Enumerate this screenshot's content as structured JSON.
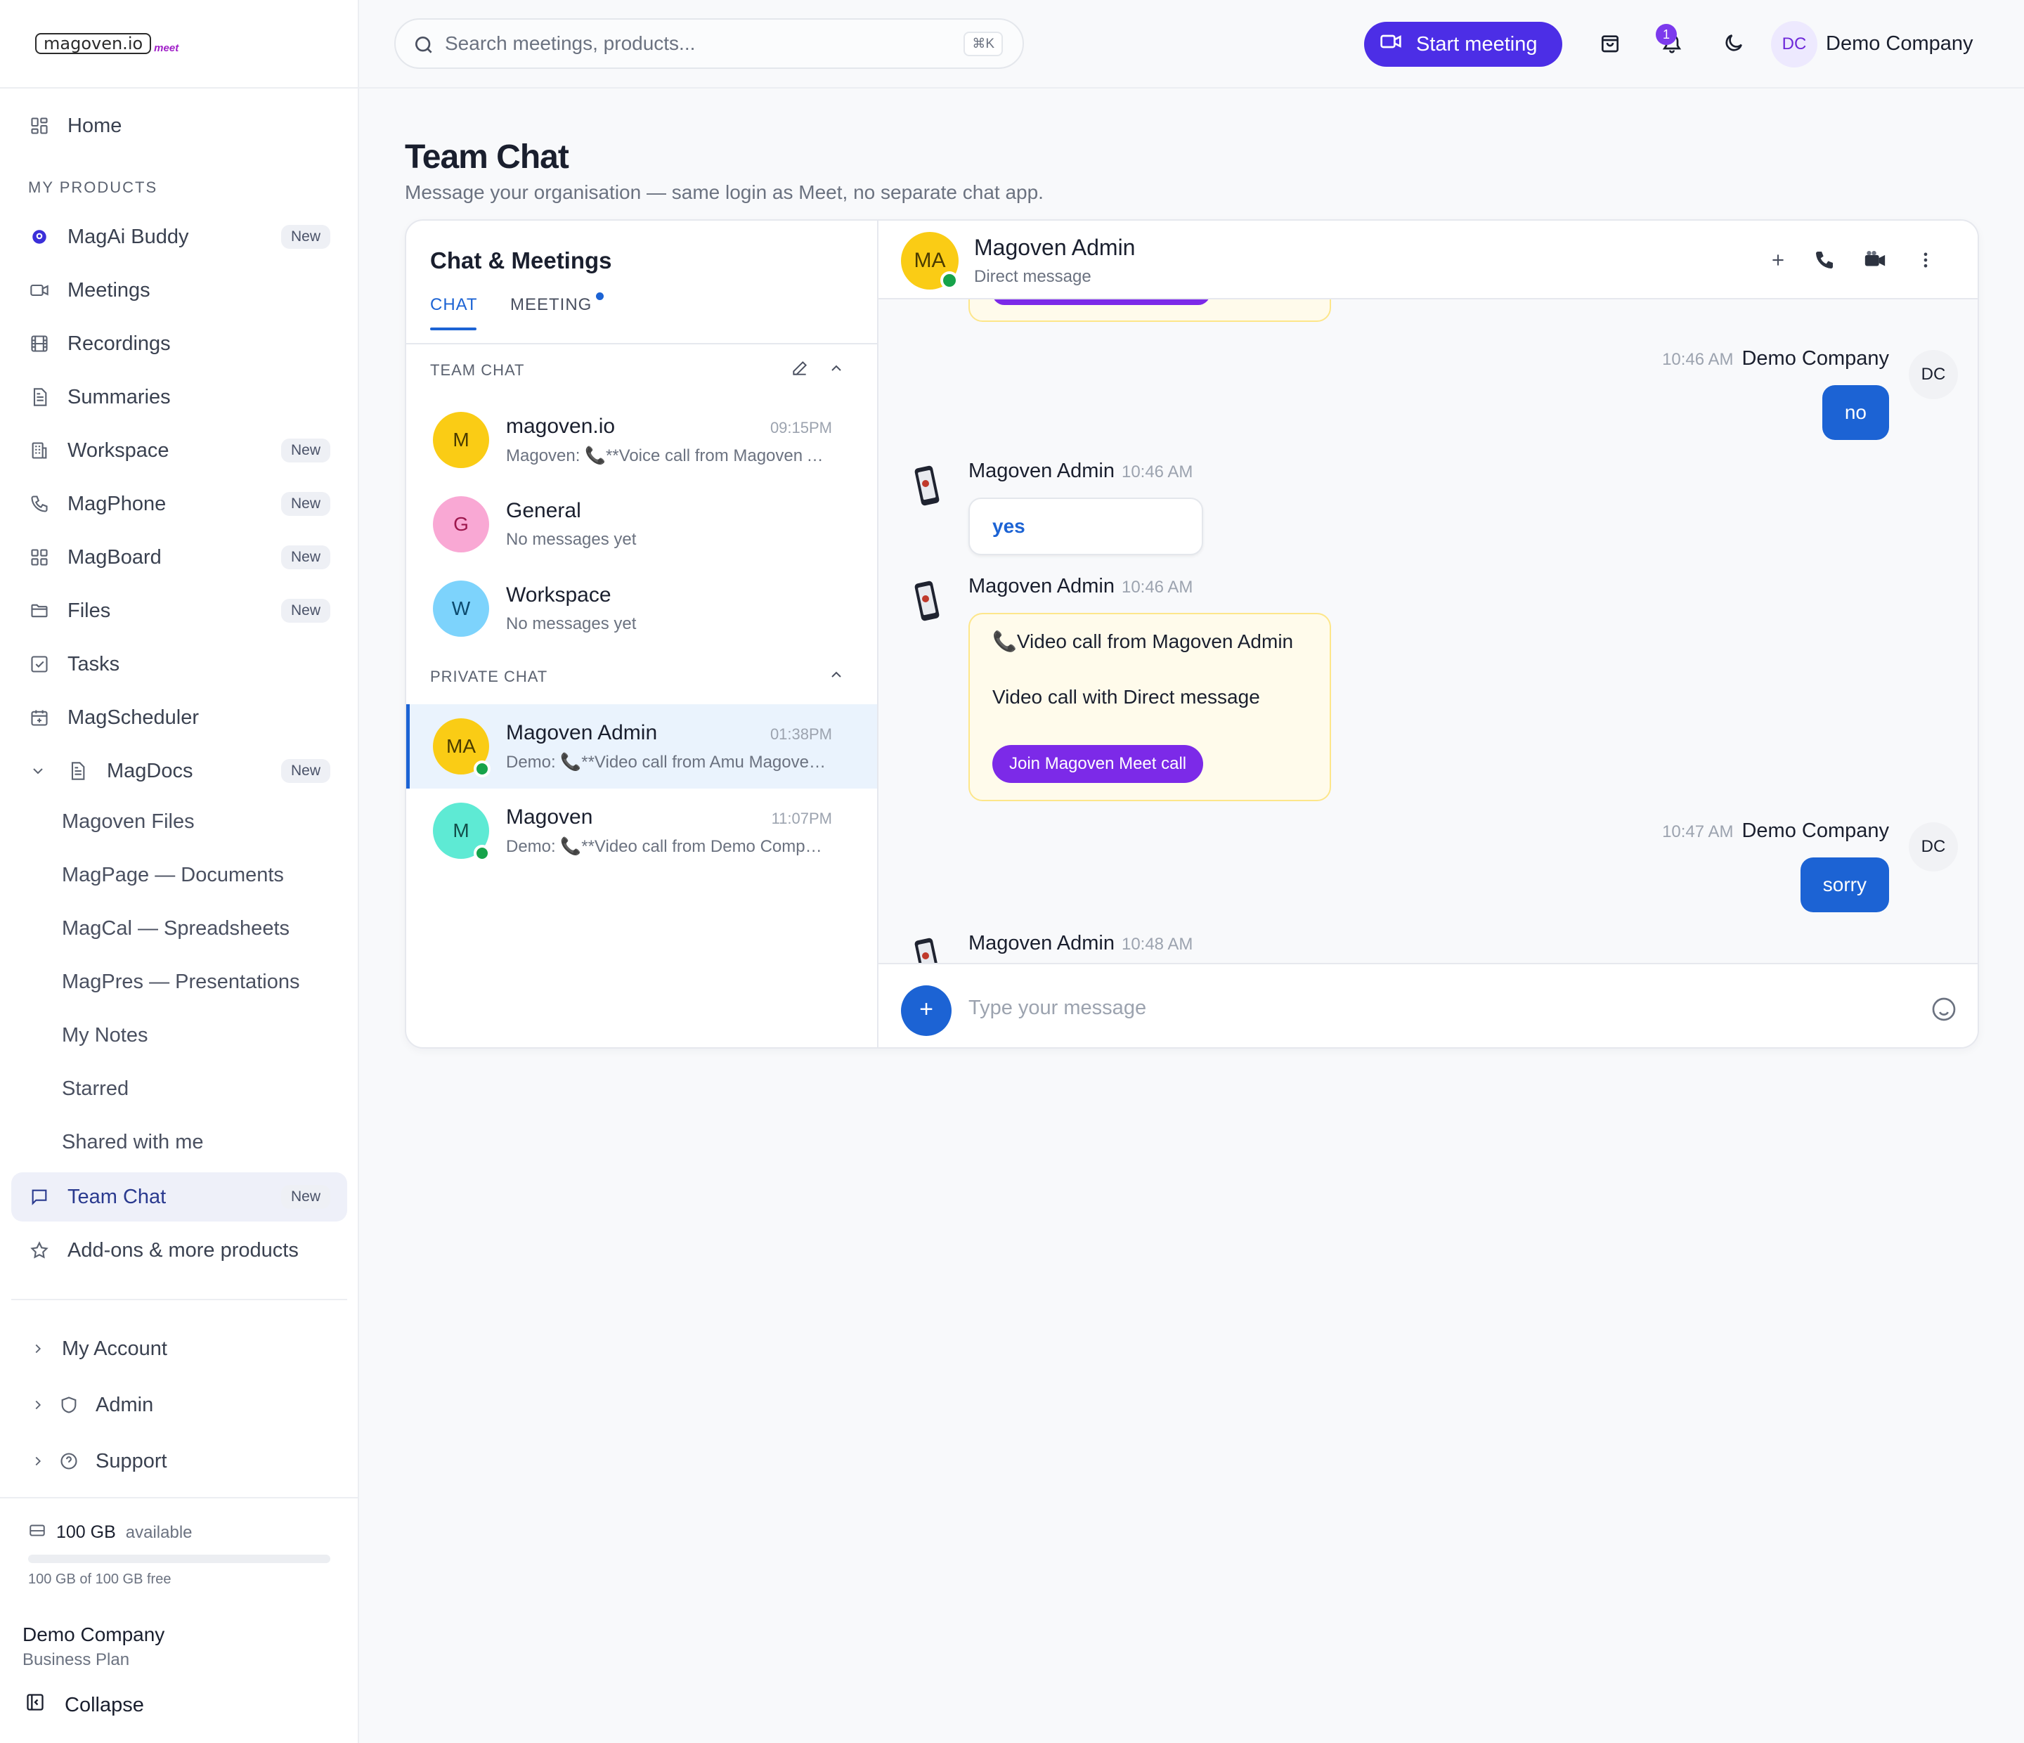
{
  "logo": {
    "main": "magoven.io",
    "sub": "meet"
  },
  "sidebar": {
    "home": "Home",
    "section_products": "MY PRODUCTS",
    "items": [
      {
        "label": "MagAi Buddy",
        "badge": "New"
      },
      {
        "label": "Meetings",
        "badge": ""
      },
      {
        "label": "Recordings",
        "badge": ""
      },
      {
        "label": "Summaries",
        "badge": ""
      },
      {
        "label": "Workspace",
        "badge": "New"
      },
      {
        "label": "MagPhone",
        "badge": "New"
      },
      {
        "label": "MagBoard",
        "badge": "New"
      },
      {
        "label": "Files",
        "badge": "New"
      },
      {
        "label": "Tasks",
        "badge": ""
      },
      {
        "label": "MagScheduler",
        "badge": ""
      },
      {
        "label": "MagDocs",
        "badge": "New"
      }
    ],
    "magdocs_sub": [
      "Magoven Files",
      "MagPage — Documents",
      "MagCal — Spreadsheets",
      "MagPres — Presentations",
      "My Notes",
      "Starred",
      "Shared with me"
    ],
    "team_chat": {
      "label": "Team Chat",
      "badge": "New"
    },
    "addons": "Add-ons & more products",
    "bottom": [
      "My Account",
      "Admin",
      "Support"
    ],
    "storage": {
      "amount": "100 GB",
      "available": "available",
      "detail": "100 GB of 100 GB free",
      "used_fraction": 0.0
    },
    "company": "Demo Company",
    "plan": "Business Plan",
    "collapse": "Collapse"
  },
  "topbar": {
    "search_placeholder": "Search meetings, products...",
    "shortcut": "⌘K",
    "start_meeting": "Start meeting",
    "notif_count": "1",
    "user_initials": "DC",
    "user_name": "Demo Company"
  },
  "page": {
    "title": "Team Chat",
    "subtitle": "Message your organisation — same login as Meet, no separate chat app."
  },
  "chat_list": {
    "title": "Chat & Meetings",
    "tabs": [
      "CHAT",
      "MEETING"
    ],
    "team_label": "TEAM CHAT",
    "private_label": "PRIVATE CHAT",
    "team": [
      {
        "initial": "M",
        "name": "magoven.io",
        "time": "09:15PM",
        "preview": "Magoven: 📞**Voice call from Magoven Admin**",
        "color": "#facc15",
        "fg": "#4a3b00"
      },
      {
        "initial": "G",
        "name": "General",
        "time": "",
        "preview": "No messages yet",
        "color": "#f9a8d4",
        "fg": "#9d174d"
      },
      {
        "initial": "W",
        "name": "Workspace",
        "time": "",
        "preview": "No messages yet",
        "color": "#7dd3fc",
        "fg": "#0c4a6e"
      }
    ],
    "private": [
      {
        "initial": "MA",
        "name": "Magoven Admin",
        "time": "01:38PM",
        "preview": "Demo: 📞**Video call from Amu Magoven Admin**",
        "color": "#facc15",
        "fg": "#4a3b00"
      },
      {
        "initial": "M",
        "name": "Magoven",
        "time": "11:07PM",
        "preview": "Demo: 📞**Video call from Demo Company**",
        "color": "#5eead4",
        "fg": "#134e4a"
      }
    ]
  },
  "conversation": {
    "initials": "MA",
    "name": "Magoven Admin",
    "subtitle": "Direct message",
    "messages": [
      {
        "sender": "Demo Company",
        "time": "10:46 AM",
        "text": "no",
        "initials": "DC"
      },
      {
        "sender": "Magoven Admin",
        "time": "10:46 AM",
        "text": "yes"
      },
      {
        "sender": "Magoven Admin",
        "time": "10:46 AM",
        "call_title": "📞Video call from Magoven Admin",
        "call_desc": "Video call with Direct message",
        "join": "Join Magoven Meet call"
      },
      {
        "sender": "Demo Company",
        "time": "10:47 AM",
        "text": "sorry",
        "initials": "DC"
      },
      {
        "sender": "Magoven Admin",
        "time": "10:48 AM"
      }
    ],
    "composer_placeholder": "Type your message"
  },
  "colors": {
    "accent": "#1c63d4",
    "brand": "#4c2ee6",
    "join": "#7c2ae8",
    "online": "#16a34a"
  }
}
